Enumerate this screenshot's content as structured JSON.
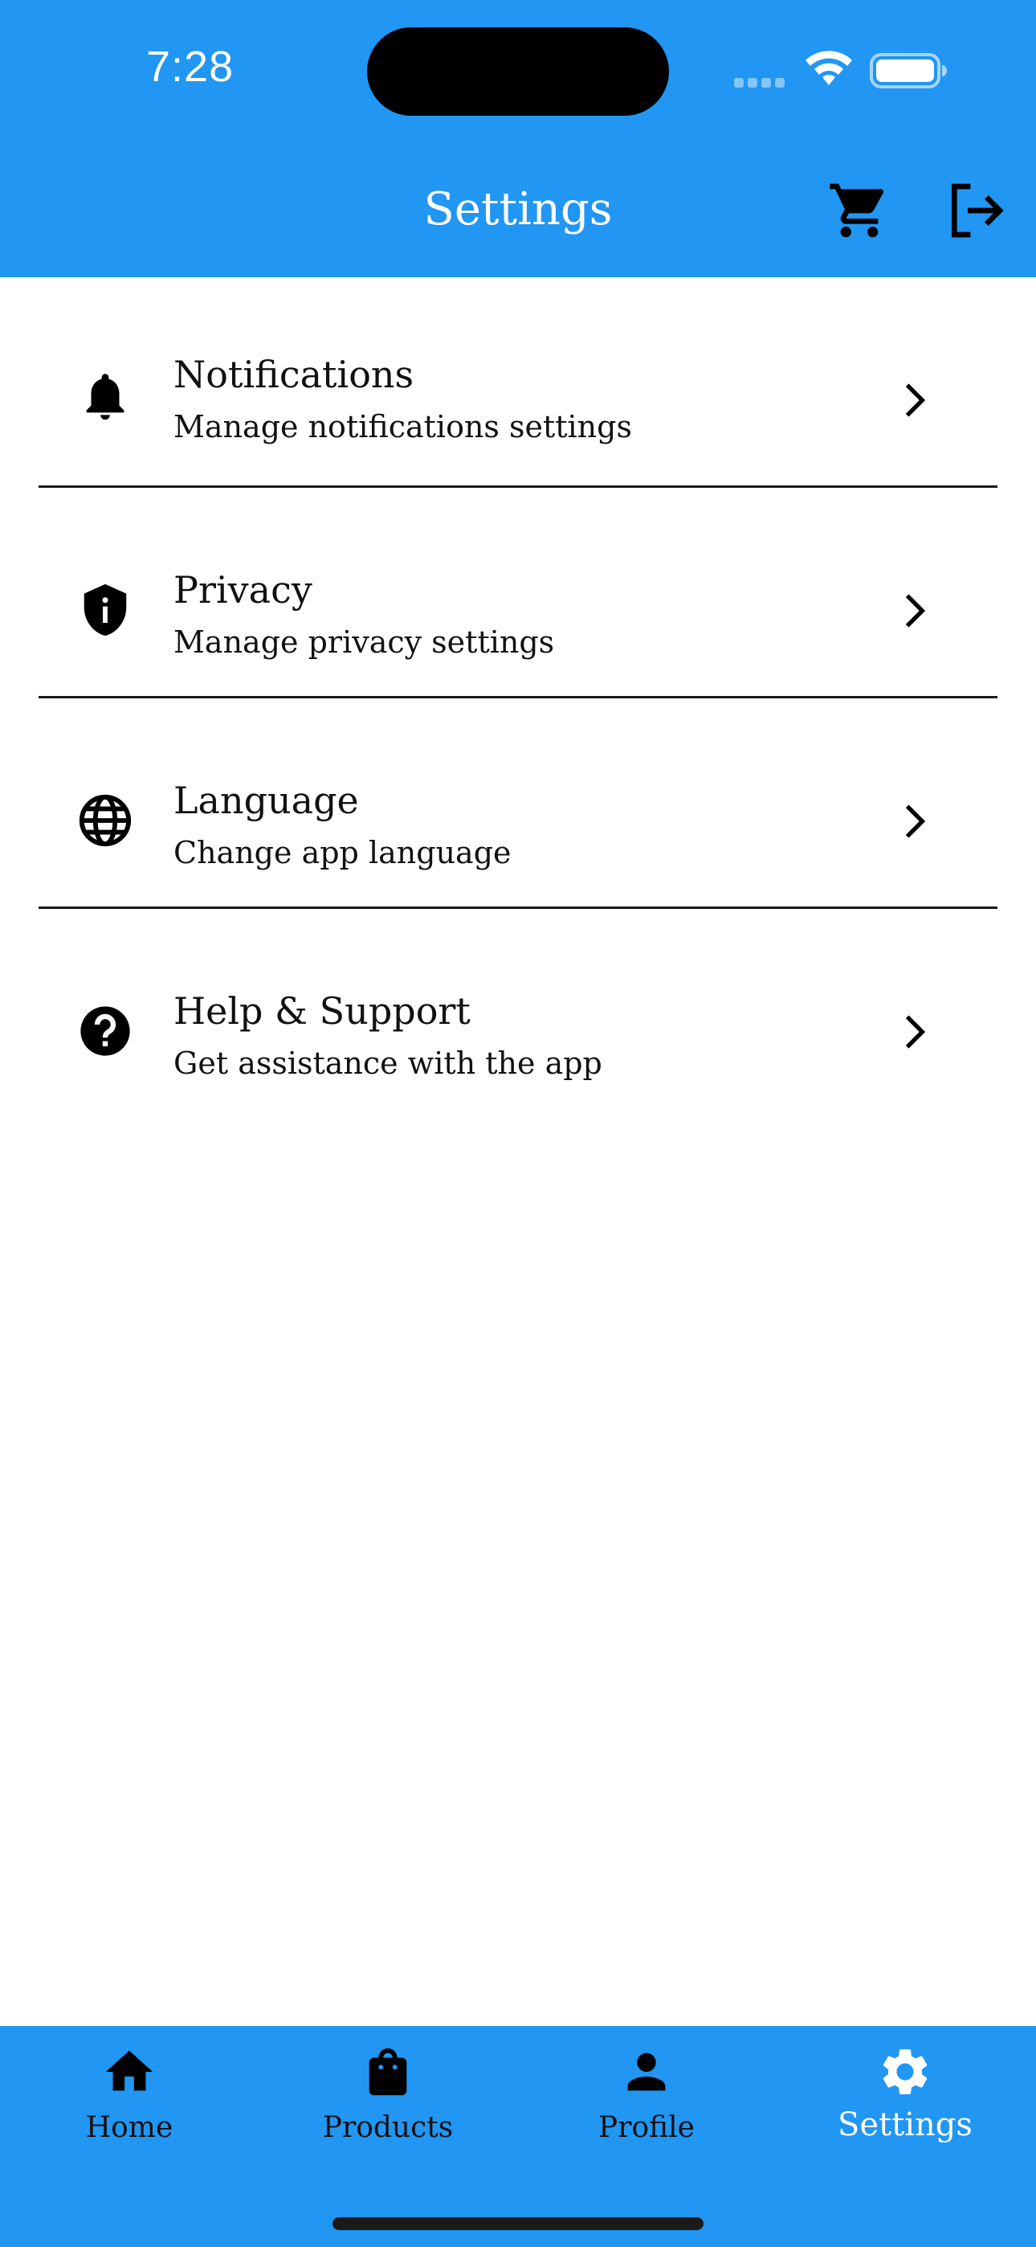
{
  "status_bar": {
    "time": "7:28",
    "icons": [
      "signal-dots-icon",
      "wifi-icon",
      "battery-icon"
    ]
  },
  "app_bar": {
    "title": "Settings",
    "actions": [
      {
        "icon": "cart-icon"
      },
      {
        "icon": "logout-icon"
      }
    ]
  },
  "settings": {
    "items": [
      {
        "icon": "bell-icon",
        "title": "Notifications",
        "subtitle": "Manage notifications settings"
      },
      {
        "icon": "shield-info-icon",
        "title": "Privacy",
        "subtitle": "Manage privacy settings"
      },
      {
        "icon": "globe-icon",
        "title": "Language",
        "subtitle": "Change app language"
      },
      {
        "icon": "help-icon",
        "title": "Help & Support",
        "subtitle": "Get assistance with the app"
      }
    ]
  },
  "bottom_nav": {
    "items": [
      {
        "icon": "home-icon",
        "label": "Home"
      },
      {
        "icon": "shopping-bag-icon",
        "label": "Products"
      },
      {
        "icon": "person-icon",
        "label": "Profile"
      },
      {
        "icon": "gear-icon",
        "label": "Settings",
        "active": true
      }
    ]
  },
  "colors": {
    "primary": "#2196F3",
    "background": "#FFFFFF",
    "text": "#111111",
    "active_nav": "#FFFFFF"
  }
}
